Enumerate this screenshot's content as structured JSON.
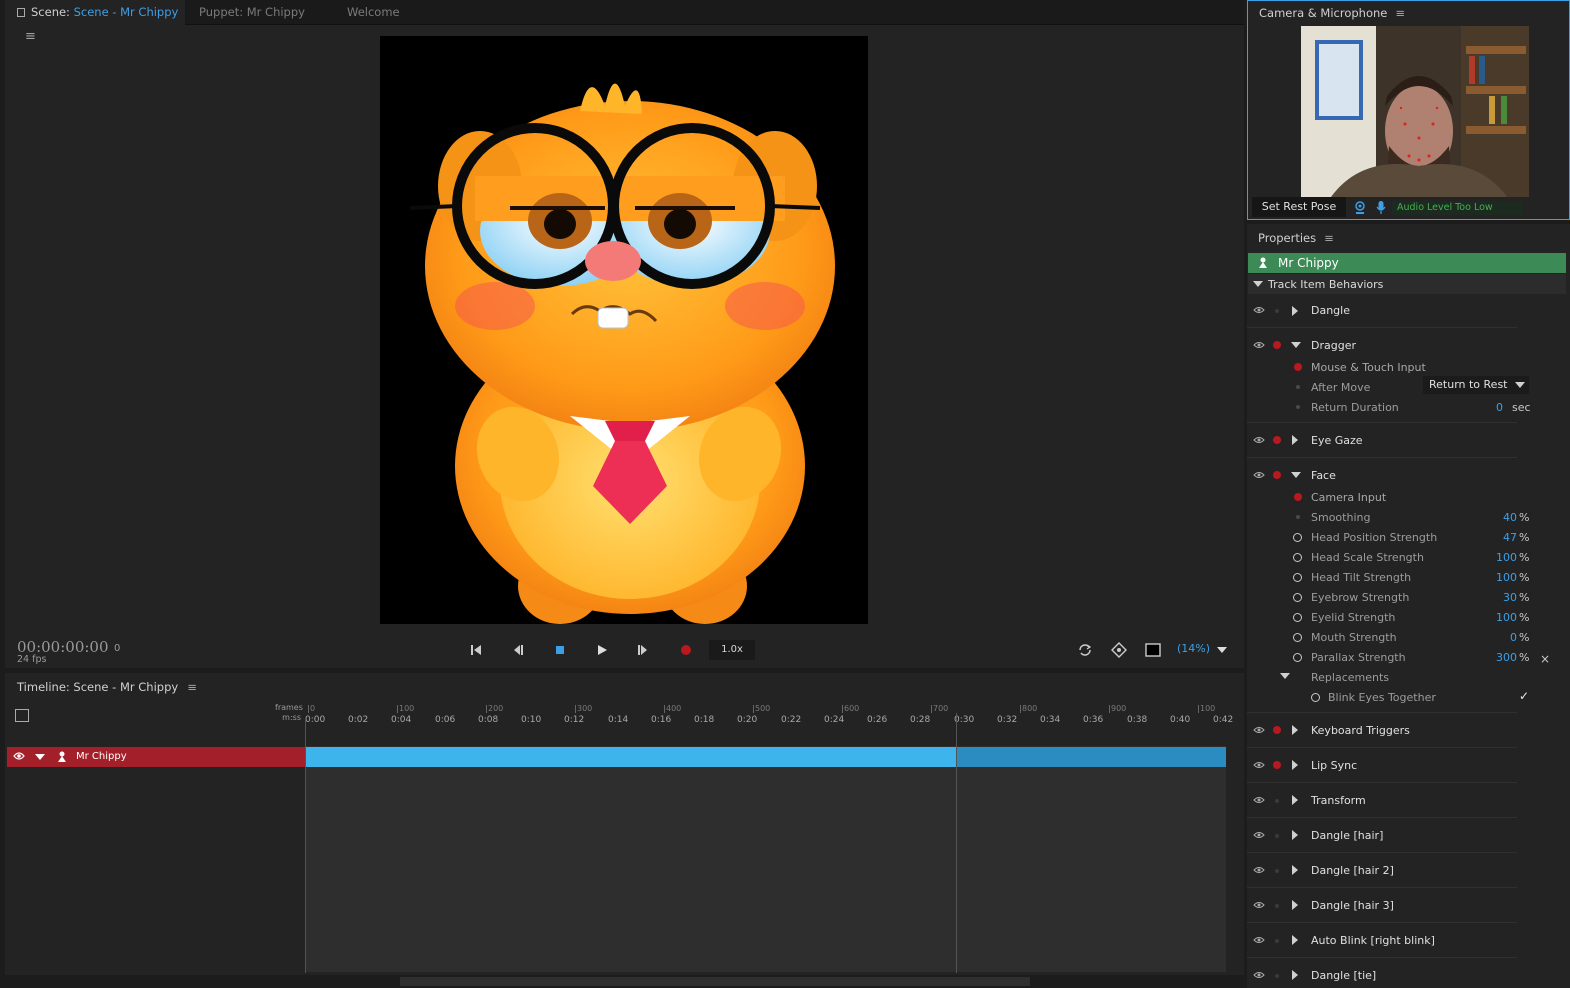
{
  "scene_panel": {
    "tabs": [
      {
        "prefix": "Scene: ",
        "accent": "Scene - Mr Chippy",
        "active": true
      },
      {
        "prefix": "Puppet: Mr Chippy",
        "accent": "",
        "active": false
      },
      {
        "prefix": "Welcome",
        "accent": "",
        "active": false
      }
    ],
    "menu_glyph": "≡",
    "timecode": "00:00:00:00",
    "frame": "0",
    "fps": "24 fps",
    "speed": "1.0x",
    "zoom": "(14%)"
  },
  "timeline": {
    "title": "Timeline: Scene - Mr Chippy",
    "row_labels": {
      "frames": "frames",
      "time": "m:ss"
    },
    "frame_ticks": [
      "0",
      "100",
      "200",
      "300",
      "400",
      "500",
      "600",
      "700",
      "800",
      "900",
      "100"
    ],
    "time_ticks": [
      "0:00",
      "0:02",
      "0:04",
      "0:06",
      "0:08",
      "0:10",
      "0:12",
      "0:14",
      "0:16",
      "0:18",
      "0:20",
      "0:22",
      "0:24",
      "0:26",
      "0:28",
      "0:30",
      "0:32",
      "0:34",
      "0:36",
      "0:38",
      "0:40",
      "0:42"
    ],
    "track": {
      "name": "Mr Chippy",
      "color": "#a3202a",
      "bar_color": "#3db5ec"
    }
  },
  "camera": {
    "title": "Camera & Microphone",
    "rest_pose_label": "Set Rest Pose",
    "audio_status": "Audio Level Too Low"
  },
  "properties": {
    "title": "Properties",
    "puppet": "Mr Chippy",
    "section": "Track Item Behaviors",
    "behaviors": [
      {
        "name": "Dangle"
      },
      {
        "name": "Dragger"
      },
      {
        "name": "Eye Gaze"
      },
      {
        "name": "Face"
      },
      {
        "name": "Keyboard Triggers"
      },
      {
        "name": "Lip Sync"
      },
      {
        "name": "Transform"
      },
      {
        "name": "Dangle [hair]"
      },
      {
        "name": "Dangle [hair 2]"
      },
      {
        "name": "Dangle [hair 3]"
      },
      {
        "name": "Auto Blink [right blink]"
      },
      {
        "name": "Dangle [tie]"
      }
    ],
    "dragger": {
      "mouse_touch": "Mouse & Touch Input",
      "after_move_label": "After Move",
      "after_move_value": "Return to Rest",
      "return_duration_label": "Return Duration",
      "return_duration_value": "0",
      "return_duration_unit": "sec"
    },
    "face": {
      "camera_input": "Camera Input",
      "params": [
        {
          "label": "Smoothing",
          "value": "40",
          "unit": "%"
        },
        {
          "label": "Head Position Strength",
          "value": "47",
          "unit": "%"
        },
        {
          "label": "Head Scale Strength",
          "value": "100",
          "unit": "%"
        },
        {
          "label": "Head Tilt Strength",
          "value": "100",
          "unit": "%"
        },
        {
          "label": "Eyebrow Strength",
          "value": "30",
          "unit": "%"
        },
        {
          "label": "Eyelid Strength",
          "value": "100",
          "unit": "%"
        },
        {
          "label": "Mouth Strength",
          "value": "0",
          "unit": "%"
        },
        {
          "label": "Parallax Strength",
          "value": "300",
          "unit": "%"
        }
      ],
      "replacements": "Replacements",
      "blink_eyes_together": "Blink Eyes Together",
      "blink_checked": "✓",
      "close_glyph": "×"
    }
  }
}
